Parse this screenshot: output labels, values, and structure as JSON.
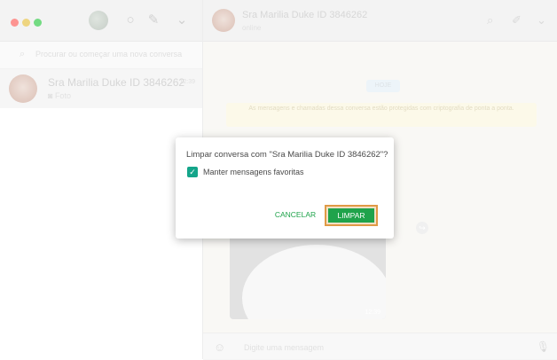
{
  "sidebar": {
    "search_placeholder": "Procurar ou começar uma nova conversa",
    "chat": {
      "name": "Sra Marilia Duke ID 3846262",
      "time": "12:39",
      "preview": "Foto"
    }
  },
  "conversation": {
    "name": "Sra Marilia Duke ID 3846262",
    "status": "online",
    "day_badge": "HOJE",
    "encryption_notice": "As mensagens e chamadas dessa conversa estão protegidas com criptografia de ponta a ponta.",
    "photo_time": "12:39",
    "compose_placeholder": "Digite uma mensagem"
  },
  "dialog": {
    "title": "Limpar conversa com \"Sra Marilia Duke ID 3846262\"?",
    "checkbox_label": "Manter mensagens favoritas",
    "checkbox_checked": true,
    "cancel_label": "CANCELAR",
    "confirm_label": "LIMPAR"
  },
  "colors": {
    "accent_green": "#1fa34b",
    "checkbox_teal": "#14a58a",
    "highlight_orange": "#e09a46"
  },
  "icons": [
    "status-icon",
    "new-chat-icon",
    "menu-chevron-icon",
    "search-icon",
    "attach-icon",
    "emoji-icon",
    "mic-icon",
    "check-icon",
    "camera-icon"
  ]
}
